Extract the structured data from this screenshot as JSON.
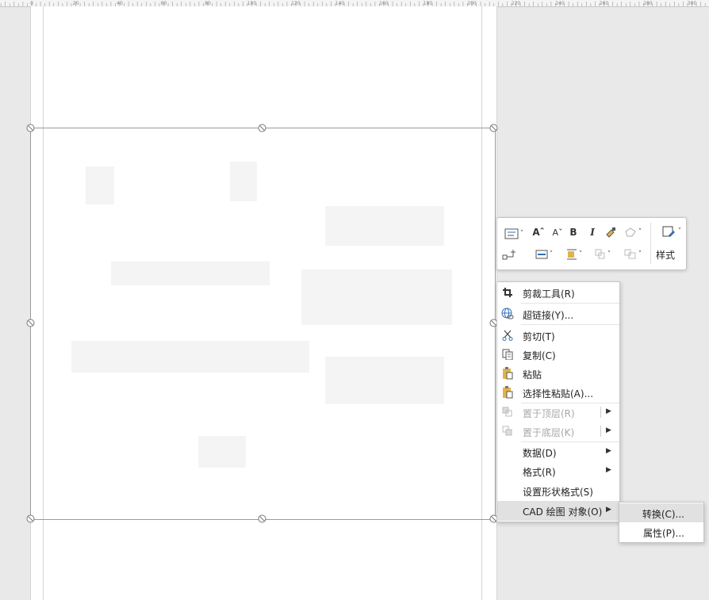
{
  "ruler": {
    "labels": [
      "0",
      "20",
      "40",
      "60",
      "80",
      "100",
      "120",
      "140",
      "160",
      "180",
      "200",
      "220",
      "240",
      "260",
      "280",
      "300"
    ]
  },
  "mini_toolbar": {
    "grow_font_glyph": "Aˆ",
    "shrink_font_glyph": "Aˇ",
    "bold_glyph": "B",
    "italic_glyph": "I",
    "styles_label": "样式",
    "caret": "˅"
  },
  "context_menu": {
    "items": [
      {
        "label": "剪裁工具(R)",
        "icon": "crop-icon",
        "enabled": true
      },
      {
        "label": "超链接(Y)...",
        "icon": "hyperlink-icon",
        "enabled": true
      },
      {
        "label": "剪切(T)",
        "icon": "scissors-icon",
        "enabled": true
      },
      {
        "label": "复制(C)",
        "icon": "copy-icon",
        "enabled": true
      },
      {
        "label": "粘贴",
        "icon": "paste-icon",
        "enabled": true
      },
      {
        "label": "选择性粘贴(A)...",
        "icon": "paste-special-icon",
        "enabled": true
      },
      {
        "label": "置于顶层(R)",
        "icon": "bring-to-front-icon",
        "enabled": false,
        "submenu": true
      },
      {
        "label": "置于底层(K)",
        "icon": "send-to-back-icon",
        "enabled": false,
        "submenu": true
      },
      {
        "label": "数据(D)",
        "icon": "",
        "enabled": true,
        "submenu": true
      },
      {
        "label": "格式(R)",
        "icon": "",
        "enabled": true,
        "submenu": true
      },
      {
        "label": "设置形状格式(S)",
        "icon": "",
        "enabled": true
      },
      {
        "label": "CAD 绘图 对象(O)",
        "icon": "",
        "enabled": true,
        "submenu": true,
        "highlighted": true
      }
    ],
    "arrow": "▶"
  },
  "submenu": {
    "items": [
      {
        "label": "转换(C)...",
        "highlighted": true
      },
      {
        "label": "属性(P)...",
        "highlighted": false
      }
    ]
  },
  "colors": {
    "accent": "#2f6fb7",
    "highlight": "#e1e1e1",
    "paste_yellow": "#e2b34a"
  }
}
